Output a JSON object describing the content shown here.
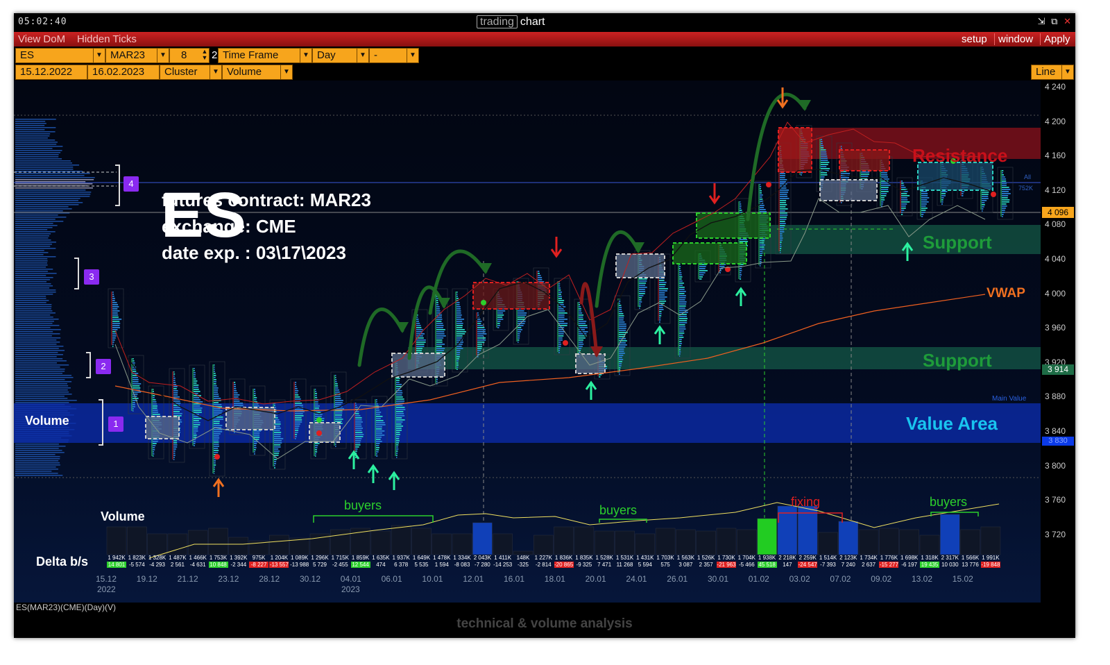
{
  "window": {
    "clock": "05:02:40",
    "title_boxed": "trading",
    "title_plain": "chart",
    "controls": [
      "⇲",
      "⧉",
      "✕"
    ]
  },
  "menu": {
    "left": [
      "View DoM",
      "Hidden Ticks"
    ],
    "right": [
      "setup",
      "window",
      "Apply"
    ]
  },
  "toolbar": {
    "symbol": "ES",
    "contract": "MAR23",
    "value": "8",
    "value_suffix": "2",
    "timeframe": "Time Frame",
    "period": "Day",
    "extra": "-",
    "date_from": "15.12.2022",
    "date_to": "16.02.2023",
    "chart_type": "Cluster",
    "cluster_mode": "Volume",
    "line_mode": "Line"
  },
  "price_axis": {
    "ticks": [
      "4 240",
      "4 200",
      "4 160",
      "4 120",
      "4 080",
      "4 040",
      "4 000",
      "3 960",
      "3 920",
      "3 880",
      "3 840",
      "3 800",
      "3 760",
      "3 720"
    ],
    "current_price": "4 096",
    "support_price": "3 914",
    "value_area_price": "3 830"
  },
  "annotations": {
    "symbol_big": "ES",
    "contract_line": "futures contract: MAR23",
    "exchange_line": "exchange: CME",
    "expiry_line": "date exp. : 03\\17\\2023",
    "resistance": "Resistance",
    "support_top": "Support",
    "support_mid": "Support",
    "vwap": "VWAP",
    "value_area": "Value Area",
    "main_value": "Main Value",
    "all_label": "All",
    "all_volume": "752K",
    "volume_profile": "Volume",
    "volume_hist": "Volume",
    "delta": "Delta b/s",
    "buyers_1": "buyers",
    "buyers_2": "buyers",
    "buyers_3": "buyers",
    "fixing": "fixing",
    "markers": [
      "1",
      "2",
      "3",
      "4"
    ]
  },
  "date_axis": {
    "labels": [
      "15.12",
      "19.12",
      "21.12",
      "23.12",
      "28.12",
      "30.12",
      "04.01",
      "06.01",
      "10.01",
      "12.01",
      "16.01",
      "18.01",
      "20.01",
      "24.01",
      "26.01",
      "30.01",
      "01.02",
      "03.02",
      "07.02",
      "09.02",
      "13.02",
      "15.02"
    ],
    "year_2022": "2022",
    "year_2023": "2023"
  },
  "volume_row": [
    "1 942K",
    "1 823K",
    "1 328K",
    "1 487K",
    "1 466K",
    "1 753K",
    "1 392K",
    "975K",
    "1 204K",
    "1 089K",
    "1 296K",
    "1 715K",
    "1 859K",
    "1 635K",
    "1 937K",
    "1 649K",
    "1 478K",
    "1 334K",
    "2 043K",
    "1 411K",
    "148K",
    "1 227K",
    "1 836K",
    "1 835K",
    "1 528K",
    "1 531K",
    "1 431K",
    "1 703K",
    "1 563K",
    "1 526K",
    "1 730K",
    "1 704K",
    "1 938K",
    "2 218K",
    "2 259K",
    "1 514K",
    "2 123K",
    "1 734K",
    "1 776K",
    "1 698K",
    "1 318K",
    "2 317K",
    "1 566K",
    "1 991K"
  ],
  "delta_row": [
    "14 801",
    "-5 574",
    "-4 293",
    "2 561",
    "-4 631",
    "10 848",
    "-2 344",
    "-8 227",
    "-13 557",
    "-13 988",
    "5 729",
    "-2 455",
    "12 544",
    "474",
    "6 378",
    "5 535",
    "1 594",
    "-8 083",
    "-7 280",
    "-14 253",
    "-325",
    "-2 814",
    "-20 865",
    "-9 325",
    "7 471",
    "11 268",
    "5 594",
    "575",
    "3 087",
    "2 357",
    "-21 963",
    "-5 466",
    "45 518",
    "147",
    "-24 547",
    "-7 393",
    "7 240",
    "2 637",
    "-15 277",
    "-6 197",
    "19 435",
    "10 030",
    "13 776",
    "-19 848"
  ],
  "status": {
    "left": "ES(MAR23)(CME)(Day)(V)",
    "footer": "technical & volume analysis"
  },
  "colors": {
    "accent_orange": "#f7a51c",
    "menu_red": "#c02020",
    "resistance": "#c0141c",
    "support": "#1e8c46",
    "value_area": "#0b2aa8",
    "vwap": "#f06020"
  }
}
